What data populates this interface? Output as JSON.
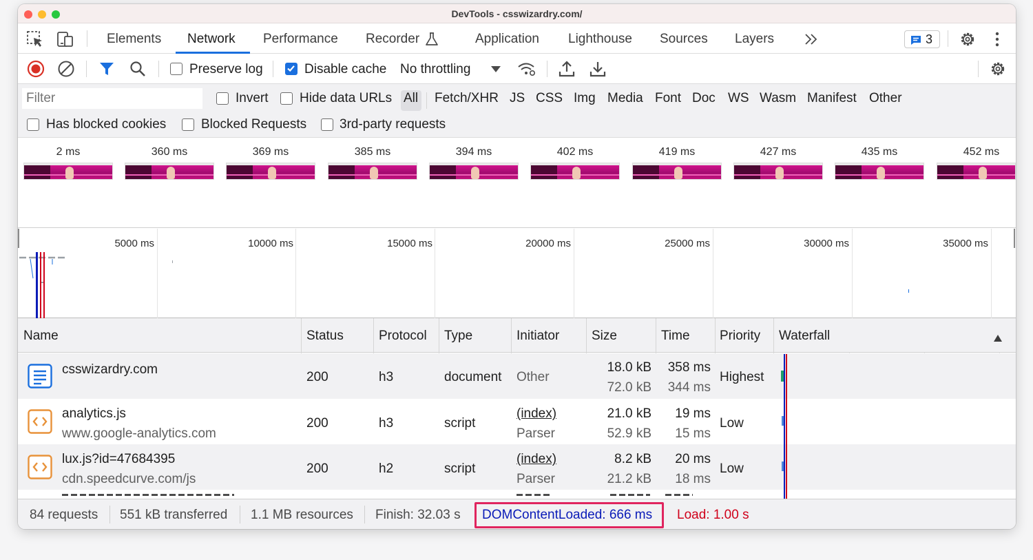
{
  "window": {
    "title": "DevTools - csswizardry.com/"
  },
  "colors": {
    "accent": "#1a6fde",
    "highlight": "#e0245e",
    "dcl": "#0a1bb8",
    "load": "#d0021b"
  },
  "icons": {
    "inspect": "inspect-element-icon",
    "device": "device-toolbar-icon",
    "more_tabs": "chevron-double-right-icon",
    "issues": "message-icon",
    "settings": "gear-icon",
    "menu": "kebab-menu-icon"
  },
  "tabs": [
    {
      "label": "Elements",
      "active": false
    },
    {
      "label": "Network",
      "active": true
    },
    {
      "label": "Performance",
      "active": false
    },
    {
      "label": "Recorder",
      "active": false
    },
    {
      "label": "Application",
      "active": false
    },
    {
      "label": "Lighthouse",
      "active": false
    },
    {
      "label": "Sources",
      "active": false
    },
    {
      "label": "Layers",
      "active": false
    }
  ],
  "issues_count": "3",
  "toolbar": {
    "preserve_log": "Preserve log",
    "preserve_log_checked": false,
    "disable_cache": "Disable cache",
    "disable_cache_checked": true,
    "throttling": "No throttling"
  },
  "filter": {
    "placeholder": "Filter",
    "invert": "Invert",
    "hide_data_urls": "Hide data URLs",
    "types": [
      "All",
      "Fetch/XHR",
      "JS",
      "CSS",
      "Img",
      "Media",
      "Font",
      "Doc",
      "WS",
      "Wasm",
      "Manifest",
      "Other"
    ],
    "active_type": "All",
    "has_blocked_cookies": "Has blocked cookies",
    "blocked_requests": "Blocked Requests",
    "third_party": "3rd-party requests"
  },
  "filmstrip": [
    "2 ms",
    "360 ms",
    "369 ms",
    "385 ms",
    "394 ms",
    "402 ms",
    "419 ms",
    "427 ms",
    "435 ms",
    "452 ms"
  ],
  "overview": {
    "ticks": [
      "5000 ms",
      "10000 ms",
      "15000 ms",
      "20000 ms",
      "25000 ms",
      "30000 ms",
      "35000 ms"
    ]
  },
  "table": {
    "columns": [
      "Name",
      "Status",
      "Protocol",
      "Type",
      "Initiator",
      "Size",
      "Time",
      "Priority",
      "Waterfall"
    ],
    "rows": [
      {
        "name": "csswizardry.com",
        "domain": "",
        "status": "200",
        "protocol": "h3",
        "type": "document",
        "initiator": "Other",
        "initiator_sub": "",
        "size": "18.0 kB",
        "size_sub": "72.0 kB",
        "time": "358 ms",
        "time_sub": "344 ms",
        "priority": "Highest",
        "icon": "document-icon"
      },
      {
        "name": "analytics.js",
        "domain": "www.google-analytics.com",
        "status": "200",
        "protocol": "h3",
        "type": "script",
        "initiator": "(index)",
        "initiator_sub": "Parser",
        "size": "21.0 kB",
        "size_sub": "52.9 kB",
        "time": "19 ms",
        "time_sub": "15 ms",
        "priority": "Low",
        "icon": "script-icon"
      },
      {
        "name": "lux.js?id=47684395",
        "domain": "cdn.speedcurve.com/js",
        "status": "200",
        "protocol": "h2",
        "type": "script",
        "initiator": "(index)",
        "initiator_sub": "Parser",
        "size": "8.2 kB",
        "size_sub": "21.2 kB",
        "time": "20 ms",
        "time_sub": "18 ms",
        "priority": "Low",
        "icon": "script-icon"
      }
    ]
  },
  "status": {
    "requests": "84 requests",
    "transferred": "551 kB transferred",
    "resources": "1.1 MB resources",
    "finish": "Finish: 32.03 s",
    "dcl": "DOMContentLoaded: 666 ms",
    "load": "Load: 1.00 s"
  }
}
